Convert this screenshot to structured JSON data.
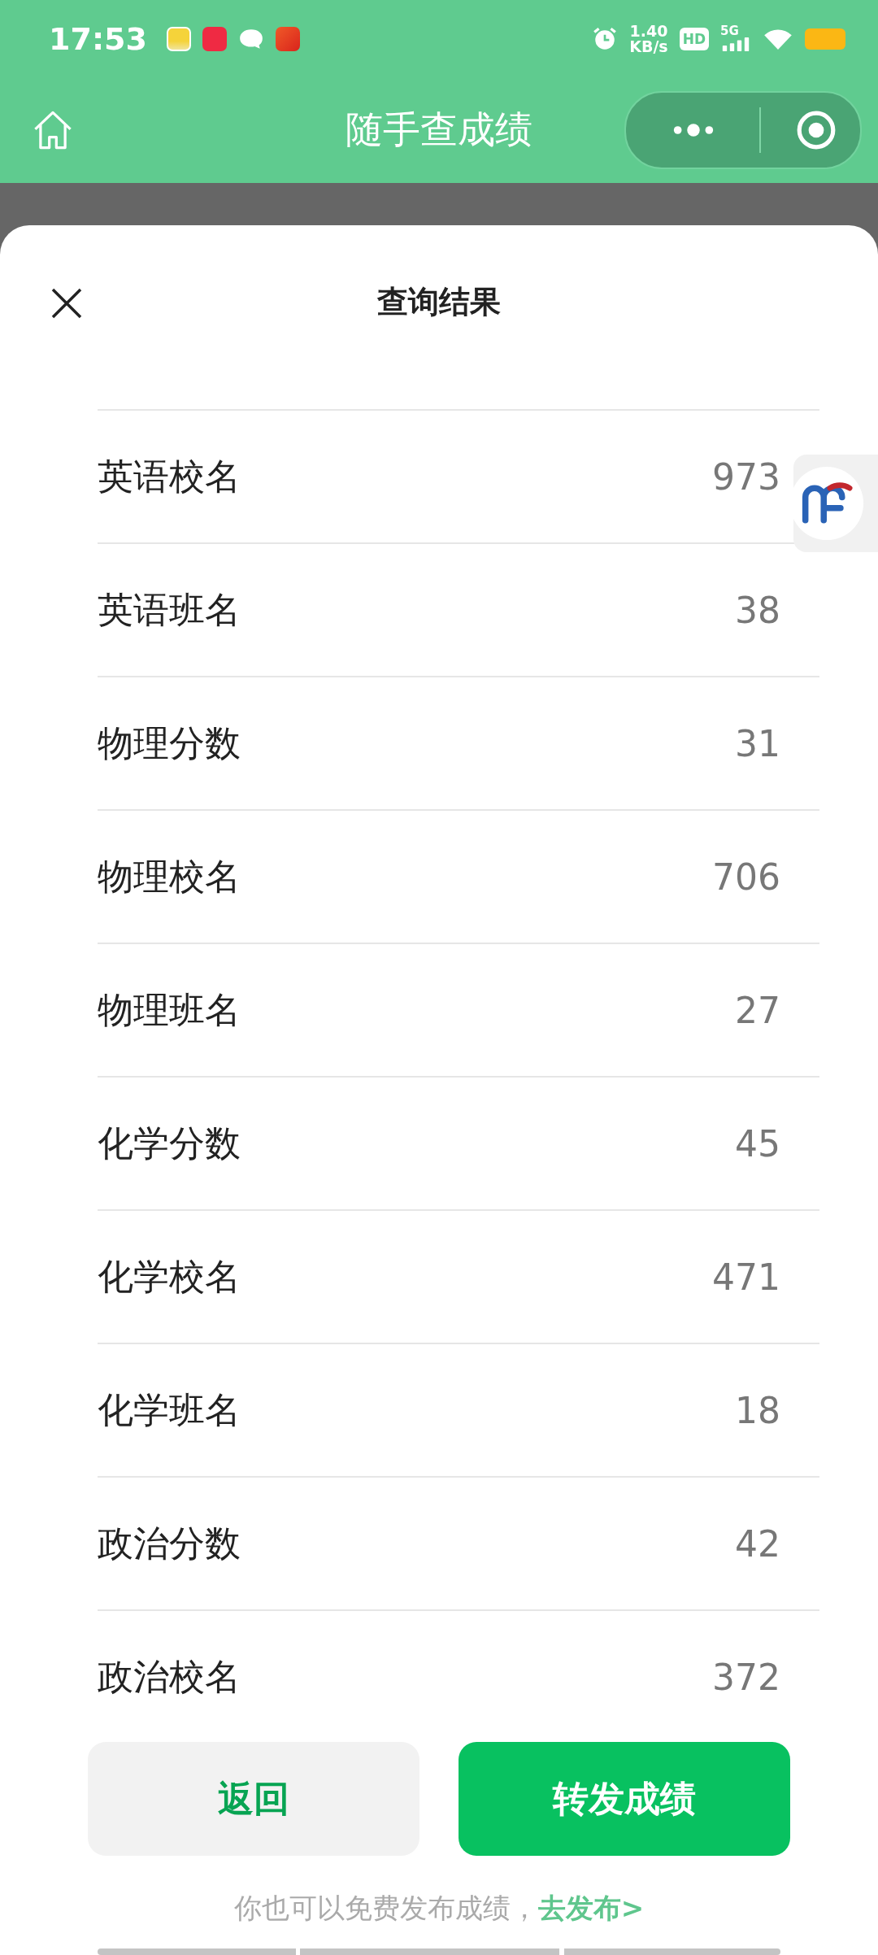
{
  "status_bar": {
    "time": "17:53",
    "speed_value": "1.40",
    "speed_unit": "KB/s",
    "hd": "HD",
    "network": "5G"
  },
  "nav_bar": {
    "title": "随手查成绩"
  },
  "sheet": {
    "title": "查询结果"
  },
  "rows": [
    {
      "label": "英语校名",
      "value": "973"
    },
    {
      "label": "英语班名",
      "value": "38"
    },
    {
      "label": "物理分数",
      "value": "31"
    },
    {
      "label": "物理校名",
      "value": "706"
    },
    {
      "label": "物理班名",
      "value": "27"
    },
    {
      "label": "化学分数",
      "value": "45"
    },
    {
      "label": "化学校名",
      "value": "471"
    },
    {
      "label": "化学班名",
      "value": "18"
    },
    {
      "label": "政治分数",
      "value": "42"
    },
    {
      "label": "政治校名",
      "value": "372"
    }
  ],
  "buttons": [
    {
      "label": "返回",
      "kind": "secondary"
    },
    {
      "label": "转发成绩",
      "kind": "primary"
    }
  ],
  "footer": {
    "text": "你也可以免费发布成绩，",
    "link": "去发布>"
  }
}
